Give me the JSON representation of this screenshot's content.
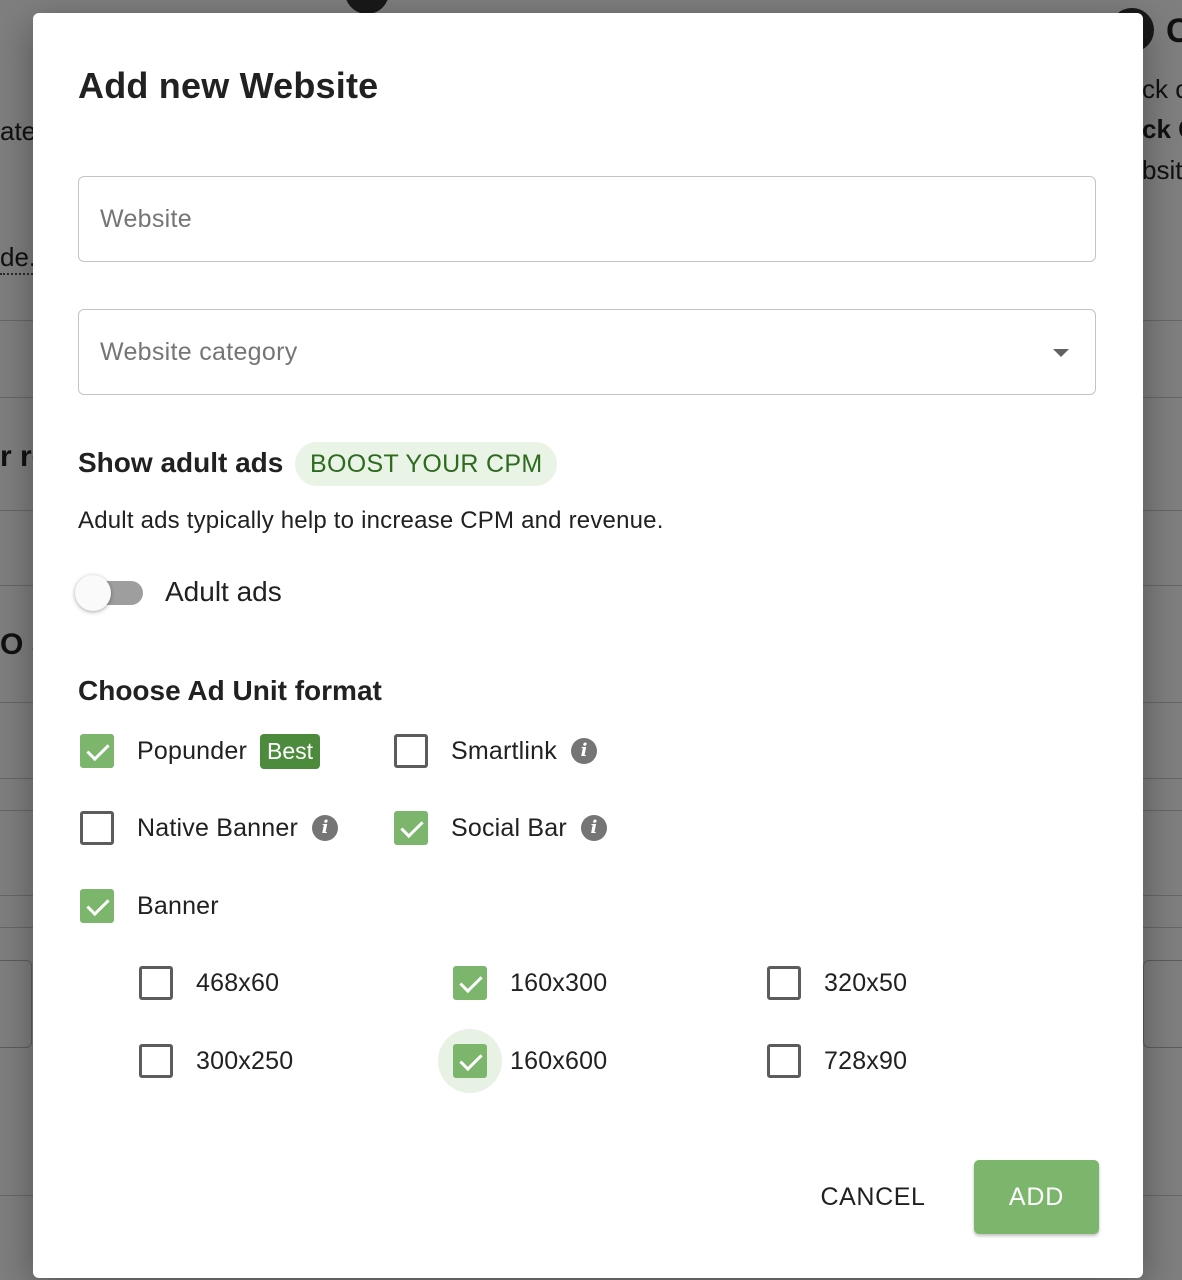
{
  "dialog": {
    "title": "Add new Website",
    "website_placeholder": "Website",
    "category_placeholder": "Website category",
    "adult": {
      "title": "Show adult ads",
      "chip": "BOOST YOUR CPM",
      "description": "Adult ads typically help to increase CPM and revenue.",
      "toggle_label": "Adult ads",
      "enabled": false
    },
    "formats": {
      "title": "Choose Ad Unit format",
      "items": [
        {
          "label": "Popunder",
          "checked": true,
          "badge": "Best"
        },
        {
          "label": "Smartlink",
          "checked": false
        },
        {
          "label": "Native Banner",
          "checked": false
        },
        {
          "label": "Social Bar",
          "checked": true
        },
        {
          "label": "Banner",
          "checked": true
        }
      ],
      "banner_sizes": [
        {
          "label": "468x60",
          "checked": false
        },
        {
          "label": "160x300",
          "checked": true
        },
        {
          "label": "320x50",
          "checked": false
        },
        {
          "label": "300x250",
          "checked": false
        },
        {
          "label": "160x600",
          "checked": true
        },
        {
          "label": "728x90",
          "checked": false
        }
      ]
    },
    "cancel_label": "CANCEL",
    "add_label": "ADD"
  },
  "colors": {
    "accent": "#7cb56c",
    "badge": "#4c8a3c",
    "chip_bg": "#eaf4e6",
    "chip_text": "#2e6b1f"
  },
  "background": {
    "fragments": [
      "ate",
      "de.",
      "r re",
      "O S",
      "ck c",
      "ck G",
      "bsit",
      "C"
    ]
  }
}
